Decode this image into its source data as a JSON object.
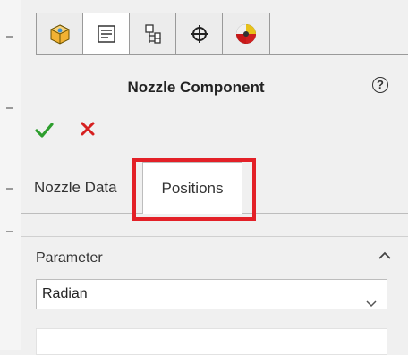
{
  "manager_tabs": [
    {
      "icon": "part-icon",
      "active": false
    },
    {
      "icon": "property-manager-icon",
      "active": true
    },
    {
      "icon": "configuration-manager-icon",
      "active": false
    },
    {
      "icon": "dimxpert-icon",
      "active": false
    },
    {
      "icon": "display-manager-icon",
      "active": false
    }
  ],
  "property_manager": {
    "title": "Nozzle Component",
    "help_icon": "?"
  },
  "tabs": {
    "nozzle_data": "Nozzle Data",
    "positions": "Positions",
    "active": "positions"
  },
  "parameter_group": {
    "label": "Parameter",
    "selected": "Radian"
  },
  "colors": {
    "highlight": "#e32027",
    "ok": "#2e9e2e",
    "cancel": "#d62020"
  }
}
